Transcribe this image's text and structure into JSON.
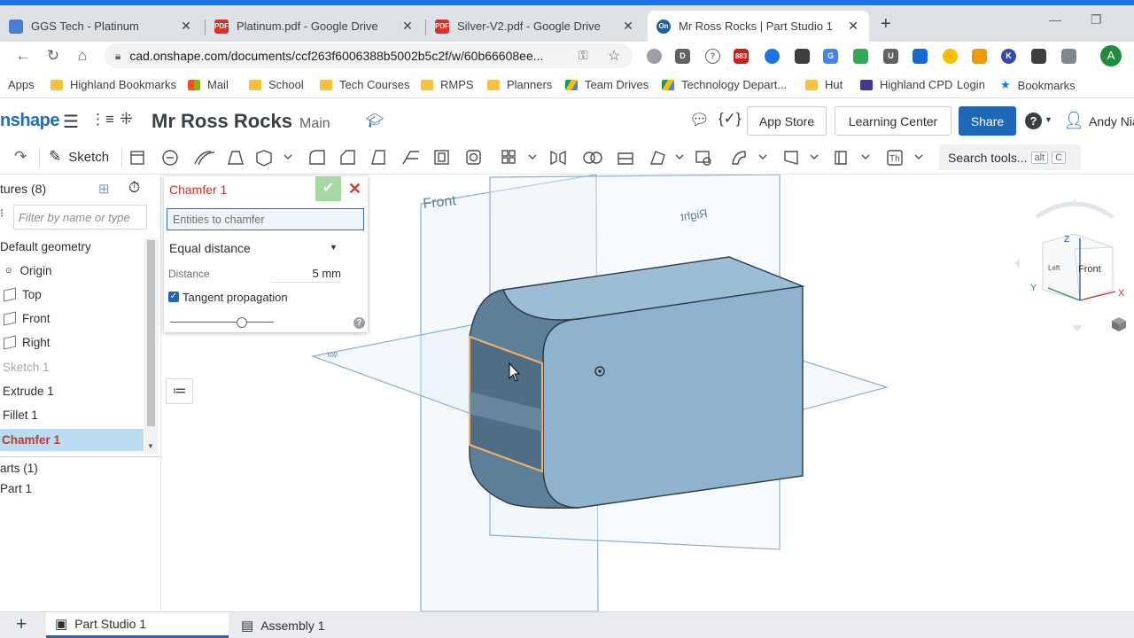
{
  "browser": {
    "tabs": [
      {
        "title": "GGS Tech - Platinum",
        "icon": "google-sites-icon",
        "color": "#4e7bd4"
      },
      {
        "title": "Platinum.pdf - Google Drive",
        "icon": "pdf-icon",
        "color": "#d93025"
      },
      {
        "title": "Silver-V2.pdf - Google Drive",
        "icon": "pdf-icon",
        "color": "#d93025"
      },
      {
        "title": "Mr Ross Rocks | Part Studio 1",
        "icon": "onshape-icon",
        "color": "#1f5fa8"
      }
    ],
    "url": "cad.onshape.com/documents/ccf263f6006388b5002b5c2f/w/60b66608ee...",
    "profile_initial": "A",
    "ext_badge": "883",
    "bookmarks": [
      "Apps",
      "Highland Bookmarks",
      "Mail",
      "School",
      "Tech Courses",
      "RMPS",
      "Planners",
      "Team Drives",
      "Technology Depart...",
      "Hut",
      "Highland CPD",
      "Login",
      "Bookmarks"
    ]
  },
  "onshape": {
    "logo": "nshape",
    "doc_title": "Mr Ross Rocks",
    "workspace": "Main",
    "app_store": "App Store",
    "learning_center": "Learning Center",
    "share": "Share",
    "help": "?",
    "user": "Andy Nia",
    "sketch_label": "Sketch",
    "search_tools": "Search tools...",
    "kbd_alt": "alt",
    "kbd_c": "C",
    "th_label": "Th"
  },
  "tree": {
    "header": "tures (8)",
    "filter_placeholder": "Filter by name or type",
    "items": [
      "Default geometry",
      "Origin",
      "Top",
      "Front",
      "Right",
      "Sketch 1",
      "Extrude 1",
      "Fillet 1",
      "Chamfer 1"
    ],
    "parts_header": "arts (1)",
    "part": "Part 1"
  },
  "dialog": {
    "title": "Chamfer 1",
    "entities_placeholder": "Entities to chamfer",
    "type": "Equal distance",
    "distance_label": "Distance",
    "distance_value": "5 mm",
    "tangent_label": "Tangent propagation",
    "tangent_checked": true,
    "help": "?"
  },
  "viewport": {
    "plane_front": "Front",
    "plane_right": "Right",
    "plane_top": "Top",
    "cube_front": "Front",
    "cube_left": "Left",
    "axis_x": "X",
    "axis_y": "Y",
    "axis_z": "Z"
  },
  "bottom_tabs": [
    "Part Studio 1",
    "Assembly 1"
  ]
}
